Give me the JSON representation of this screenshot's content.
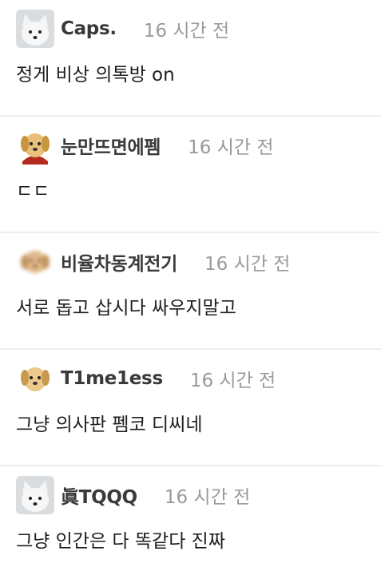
{
  "comments": [
    {
      "avatar": "white-fox-avatar-icon",
      "username": "Caps.",
      "time": "16 시간 전",
      "text": "정게 비상 의톡방 on"
    },
    {
      "avatar": "dog-avatar-icon",
      "username": "눈만뜨면에펨",
      "time": "16 시간 전",
      "text": "ㄷㄷ"
    },
    {
      "avatar": "blurred-dog-avatar-icon",
      "username": "비율차동계전기",
      "time": "16 시간 전",
      "text": "서로 돕고 삽시다 싸우지말고"
    },
    {
      "avatar": "dog-avatar-icon",
      "username": "T1me1ess",
      "time": "16 시간 전",
      "text": "그냥 의사판 펨코 디씨네"
    },
    {
      "avatar": "white-fox-avatar-icon",
      "username": "眞TQQQ",
      "time": "16 시간 전",
      "text": "그냥 인간은 다 똑같다 진짜"
    }
  ]
}
